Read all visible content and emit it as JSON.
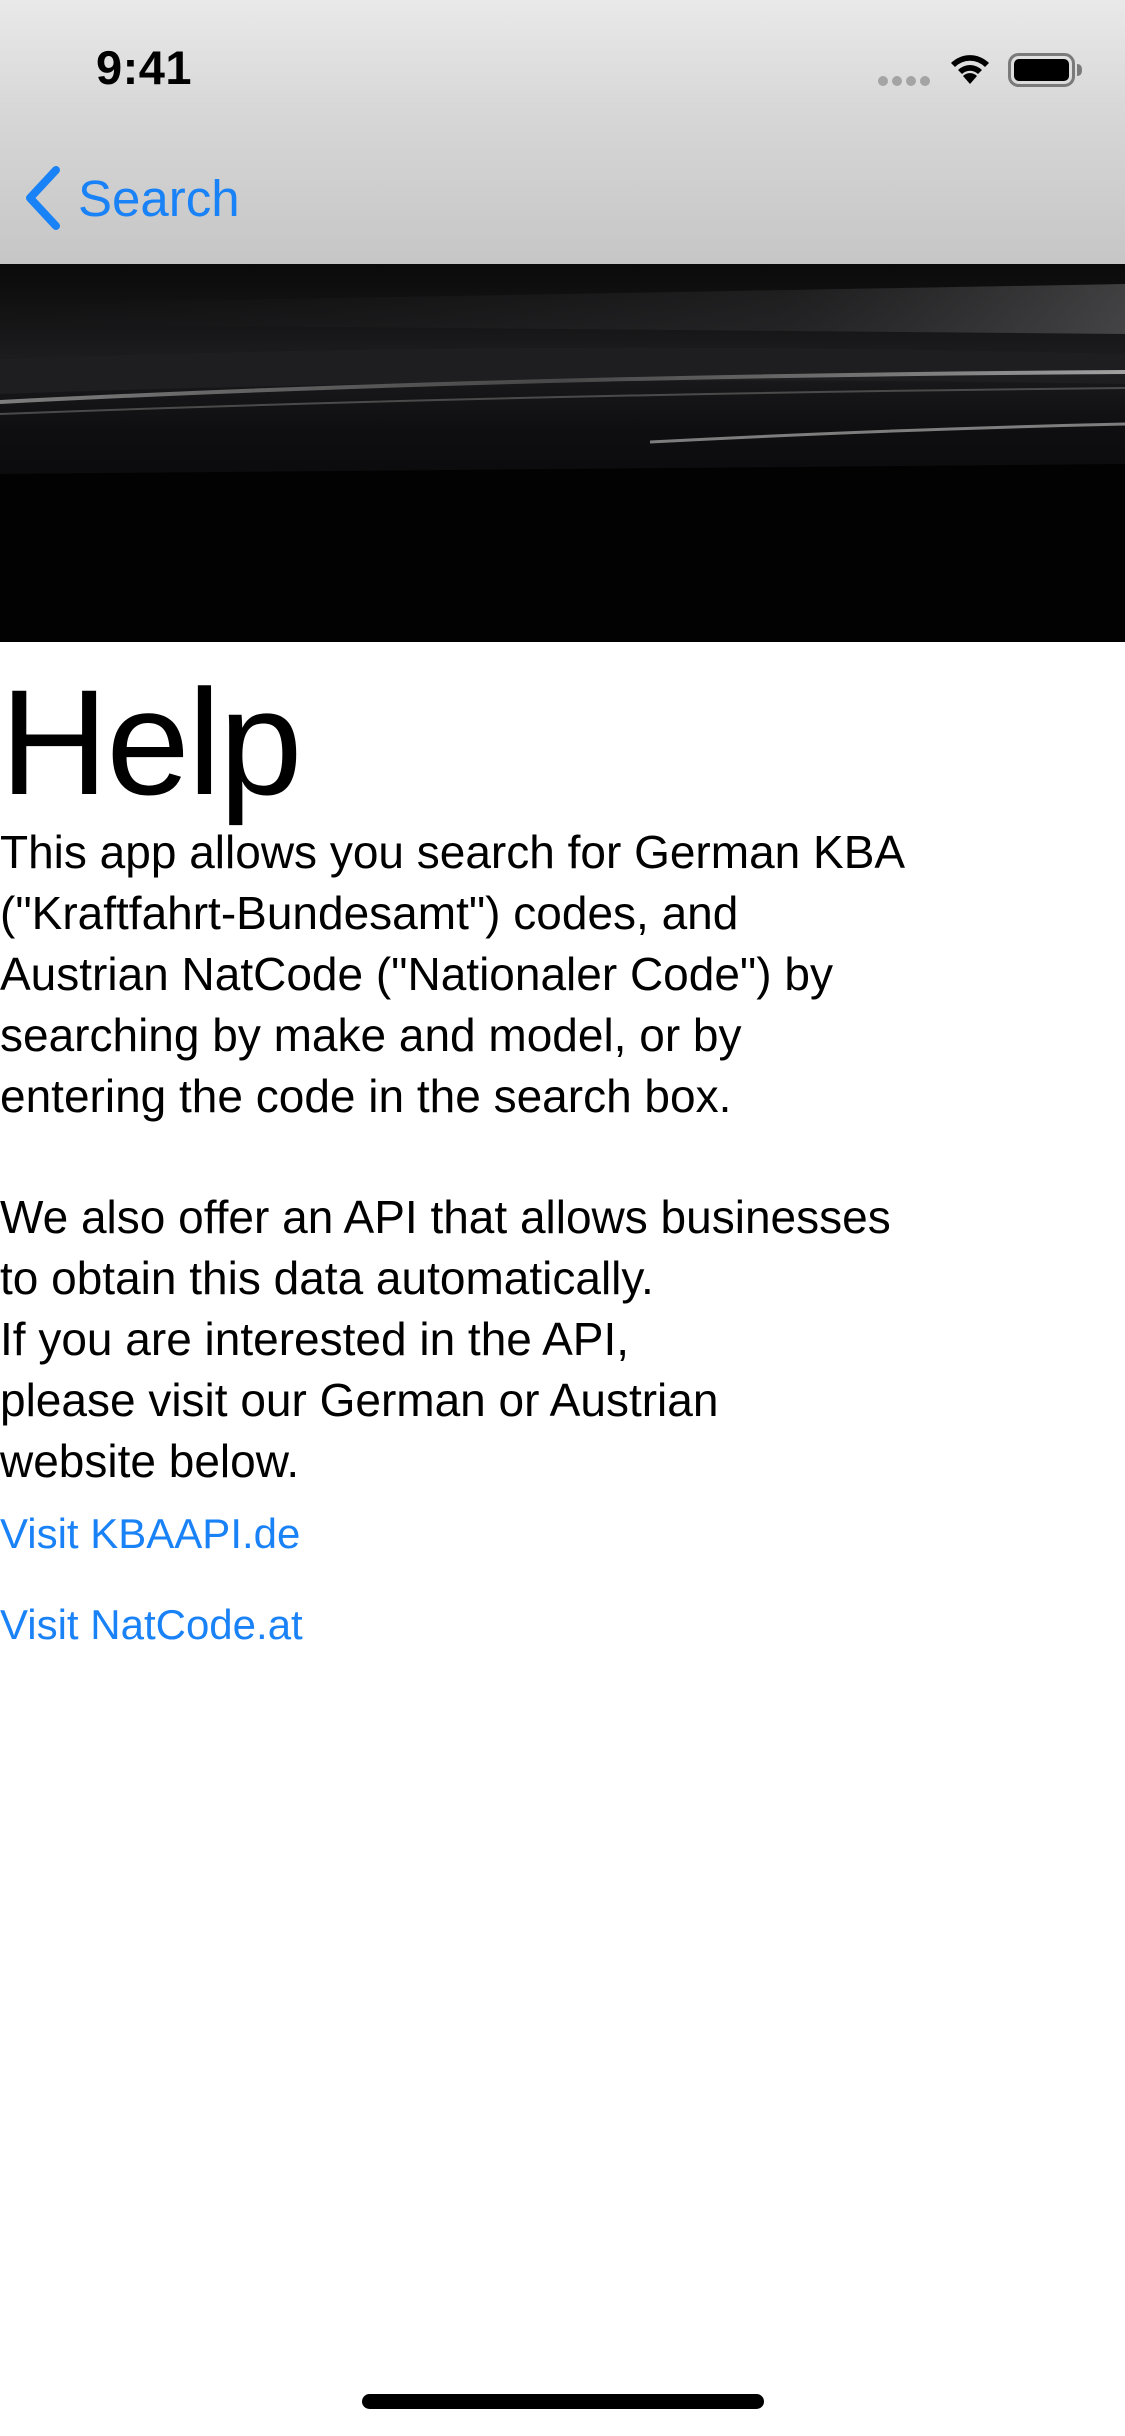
{
  "status_bar": {
    "time": "9:41",
    "icons": [
      "cellular-signal-icon",
      "wifi-icon",
      "battery-icon"
    ]
  },
  "nav_bar": {
    "back_label": "Search",
    "back_icon": "chevron-left-icon"
  },
  "hero": {
    "image": "dark road banner photo"
  },
  "content": {
    "title": "Help",
    "paragraph_1": "This app allows you search for German KBA\n(\"Kraftfahrt-Bundesamt\") codes, and\nAustrian NatCode (\"Nationaler Code\") by\nsearching by make and model, or by\nentering the code in the search box.",
    "paragraph_2": "We also offer an API that allows businesses\nto obtain this data automatically.\nIf you are interested in the API,\nplease visit our German or Austrian\nwebsite below.",
    "links": [
      {
        "label": "Visit KBAAPI.de"
      },
      {
        "label": "Visit NatCode.at"
      }
    ]
  },
  "colors": {
    "accent": "#1a82f7",
    "text": "#000000",
    "background": "#ffffff"
  }
}
